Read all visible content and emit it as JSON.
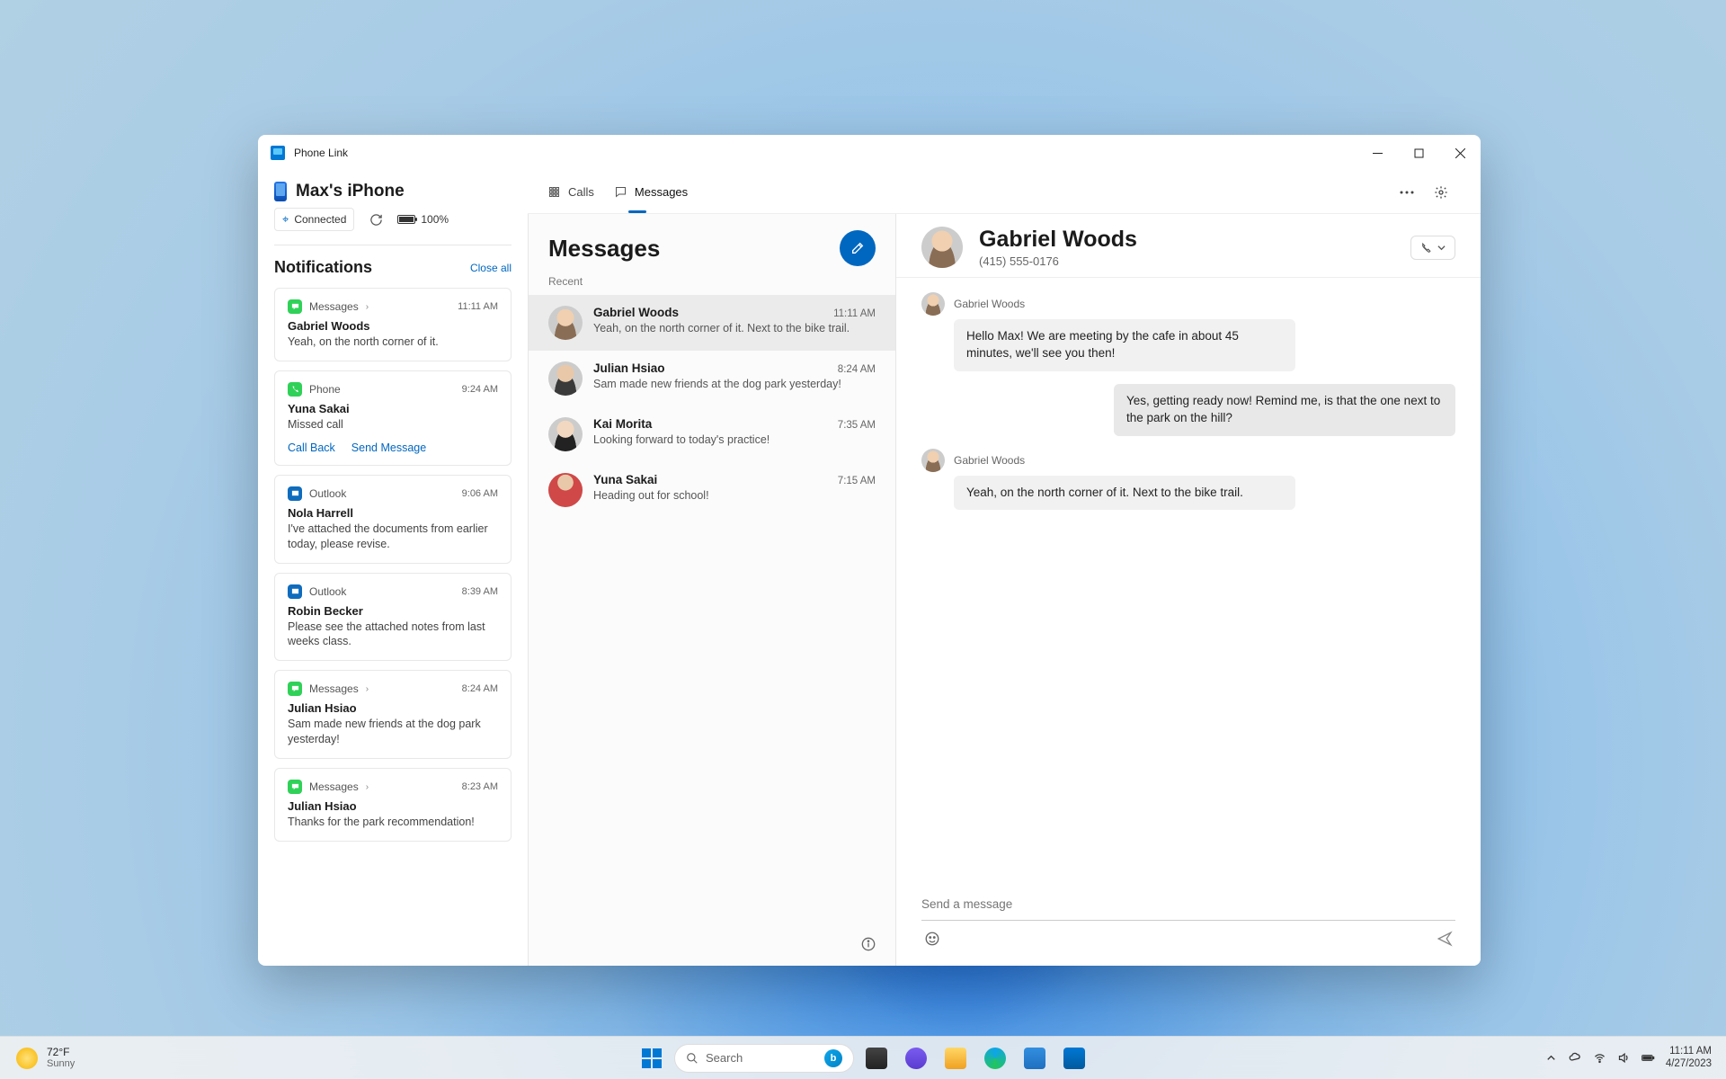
{
  "window": {
    "title": "Phone Link"
  },
  "device": {
    "name": "Max's iPhone",
    "status": "Connected",
    "battery": "100%"
  },
  "tabs": {
    "calls": "Calls",
    "messages": "Messages"
  },
  "notifications": {
    "heading": "Notifications",
    "close_all": "Close all",
    "items": [
      {
        "app": "Messages",
        "time": "11:11 AM",
        "title": "Gabriel Woods",
        "body": "Yeah, on the north corner of it."
      },
      {
        "app": "Phone",
        "time": "9:24 AM",
        "title": "Yuna Sakai",
        "body": "Missed call",
        "actions": [
          "Call Back",
          "Send Message"
        ]
      },
      {
        "app": "Outlook",
        "time": "9:06 AM",
        "title": "Nola Harrell",
        "body": "I've attached the documents from earlier today, please revise."
      },
      {
        "app": "Outlook",
        "time": "8:39 AM",
        "title": "Robin Becker",
        "body": "Please see the attached notes from last weeks class."
      },
      {
        "app": "Messages",
        "time": "8:24 AM",
        "title": "Julian Hsiao",
        "body": "Sam made new friends at the dog park yesterday!"
      },
      {
        "app": "Messages",
        "time": "8:23 AM",
        "title": "Julian Hsiao",
        "body": "Thanks for the park recommendation!"
      }
    ]
  },
  "messages": {
    "heading": "Messages",
    "recent_label": "Recent",
    "conversations": [
      {
        "name": "Gabriel Woods",
        "time": "11:11 AM",
        "preview": "Yeah, on the north corner of it. Next to the bike trail."
      },
      {
        "name": "Julian Hsiao",
        "time": "8:24 AM",
        "preview": "Sam made new friends at the dog park yesterday!"
      },
      {
        "name": "Kai Morita",
        "time": "7:35 AM",
        "preview": "Looking forward to today's practice!"
      },
      {
        "name": "Yuna Sakai",
        "time": "7:15 AM",
        "preview": "Heading out for school!"
      }
    ]
  },
  "chat": {
    "name": "Gabriel Woods",
    "number": "(415) 555-0176",
    "messages": [
      {
        "dir": "in",
        "sender": "Gabriel Woods",
        "text": "Hello Max! We are meeting by the cafe in about 45 minutes, we'll see you then!"
      },
      {
        "dir": "out",
        "text": "Yes, getting ready now! Remind me, is that the one next to the park on the hill?"
      },
      {
        "dir": "in",
        "sender": "Gabriel Woods",
        "text": "Yeah, on the north corner of it. Next to the bike trail."
      }
    ],
    "placeholder": "Send a message"
  },
  "taskbar": {
    "temp": "72°F",
    "cond": "Sunny",
    "search": "Search",
    "time": "11:11 AM",
    "date": "4/27/2023"
  }
}
